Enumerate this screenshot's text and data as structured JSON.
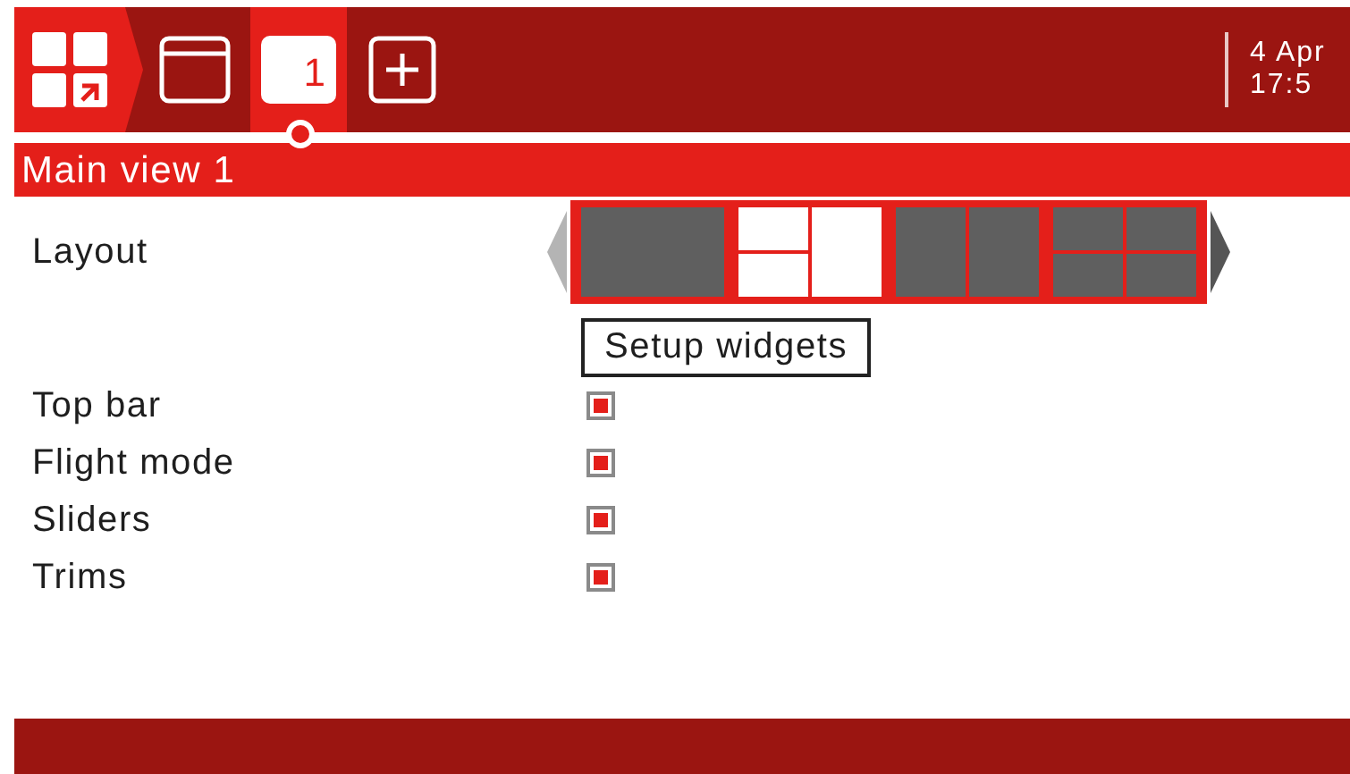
{
  "top_bar": {
    "tabs": [
      {
        "kind": "window",
        "selected": false
      },
      {
        "kind": "number",
        "label": "1",
        "selected": true
      },
      {
        "kind": "add",
        "selected": false
      }
    ],
    "date": "4 Apr",
    "time": "17:5"
  },
  "title": "Main view 1",
  "layout": {
    "label": "Layout",
    "options": [
      {
        "kind": "single",
        "selected": false
      },
      {
        "kind": "split-left",
        "selected": true
      },
      {
        "kind": "two-column",
        "selected": false
      },
      {
        "kind": "quad",
        "selected": false
      }
    ]
  },
  "setup_button": "Setup widgets",
  "options": [
    {
      "label": "Top bar",
      "checked": true
    },
    {
      "label": "Flight mode",
      "checked": true
    },
    {
      "label": "Sliders",
      "checked": true
    },
    {
      "label": "Trims",
      "checked": true
    }
  ]
}
